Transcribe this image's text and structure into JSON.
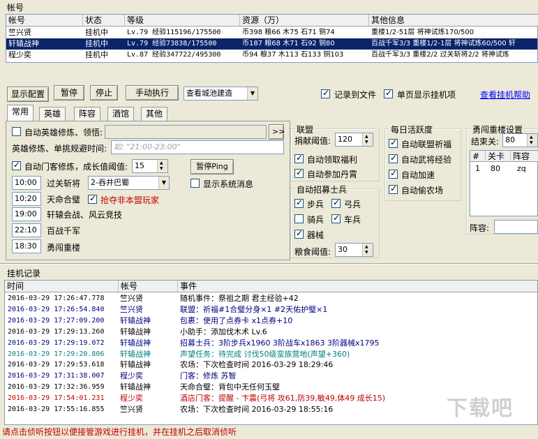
{
  "accounts": {
    "section_title": "帐号",
    "columns": [
      "帐号",
      "状态",
      "等级",
      "资源（万）",
      "其他信息"
    ],
    "rows": [
      {
        "name": "竺兴贤",
        "status": "挂机中",
        "level": "Lv.79 经验115196/175500",
        "res": "币398 粮66 木75 石71 铜74",
        "other": "重楼1/2-51层 将神试炼170/500"
      },
      {
        "name": "轩辕战神",
        "status": "挂机中",
        "level": "Lv.79 经验73838/175500",
        "res": "币187 粮68 木71 石92 铜80",
        "other": "百战千军3/3 重楼1/2-1层 将神试炼60/500 轩"
      },
      {
        "name": "程少奕",
        "status": "挂机中",
        "level": "Lv.87 经验347722/495300",
        "res": "币94 粮37 木113 石133 铜103",
        "other": "百战千军3/3 重楼2/2 过关斩将2/2 将神试炼"
      }
    ]
  },
  "toolbar": {
    "show_config": "显示配置",
    "pause": "暂停",
    "stop": "停止",
    "manual": "手动执行",
    "select_value": "查看城池建造",
    "record_file": "记录到文件",
    "single_page": "单页显示挂机项",
    "help_link": "查看挂机帮助"
  },
  "tabs": [
    "常用",
    "英雄",
    "阵容",
    "酒馆",
    "其他"
  ],
  "common": {
    "auto_hero": "自动英雄修炼、领悟:",
    "hero_time_label": "英雄修炼、单挑规避时间:",
    "hero_time_placeholder": "如: \"21:00-23:00\"",
    "auto_guest": "自动门客修炼，成长值阈值:",
    "guest_value": "15",
    "pause_ping": "暂停Ping",
    "show_sys_msg": "显示系统消息",
    "schedule": [
      {
        "time": "10:00",
        "label": "过关斩将"
      },
      {
        "time": "10:20",
        "label": "天命合璧"
      },
      {
        "time": "19:00",
        "label": "轩辕会战、风云竞技"
      },
      {
        "time": "22:10",
        "label": "百战千军"
      },
      {
        "time": "18:30",
        "label": "勇闯重楼"
      }
    ],
    "guanqia_select": "2-吞并巴蜀",
    "grab_non_alliance": "抢夺非本盟玩家"
  },
  "alliance": {
    "title": "联盟",
    "donate_label": "捐献阈值:",
    "donate_value": "120",
    "auto_benefit": "自动领取福利",
    "auto_pill": "自动参加丹霄"
  },
  "recruit": {
    "title": "自动招募士兵",
    "infantry": "步兵",
    "archer": "弓兵",
    "cavalry": "骑兵",
    "chariot": "车兵",
    "machine": "器械",
    "food_label": "粮食阈值:",
    "food_value": "30"
  },
  "daily": {
    "title": "每日活跃度",
    "items": [
      "自动联盟祈福",
      "自动武将经验",
      "自动加速",
      "自动偷农场"
    ]
  },
  "tower": {
    "title": "勇闯重楼设置",
    "end_label": "结束关:",
    "end_value": "80",
    "columns": [
      "#",
      "关卡",
      "阵容"
    ],
    "rows": [
      {
        "num": "1",
        "stage": "80",
        "team": "zq"
      }
    ],
    "team_label": "阵容:"
  },
  "log": {
    "title": "挂机记录",
    "columns": [
      "时间",
      "帐号",
      "事件"
    ],
    "rows": [
      {
        "time": "2016-03-29 17:26:47.778",
        "account": "竺兴贤",
        "event": "随机事件：祭祖之期 君主经验+42",
        "color": "#000000"
      },
      {
        "time": "2016-03-29 17:26:54.840",
        "account": "竺兴贤",
        "event": "联盟：祈福#1合璧分身×1 #2天佑护璧×1",
        "color": "#000080"
      },
      {
        "time": "2016-03-29 17:27:09.200",
        "account": "轩辕战神",
        "event": "包裹：使用了点券卡 x1点券+10",
        "color": "#000080"
      },
      {
        "time": "2016-03-29 17:29:13.260",
        "account": "轩辕战神",
        "event": "小助手：添加伐木术 Lv.6",
        "color": "#000000"
      },
      {
        "time": "2016-03-29 17:29:19.072",
        "account": "轩辕战神",
        "event": "招募士兵：3阶步兵x1960 3阶战车x1863 3阶器械x1795",
        "color": "#000080"
      },
      {
        "time": "2016-03-29 17:29:20.806",
        "account": "轩辕战神",
        "event": "声望任务：待完成 讨伐50级蛮族营地(声望+360)",
        "color": "#008080"
      },
      {
        "time": "2016-03-29 17:29:53.618",
        "account": "轩辕战神",
        "event": "农场：下次检查时间 2016-03-29 18:29:46",
        "color": "#000000"
      },
      {
        "time": "2016-03-29 17:31:38.007",
        "account": "程少奕",
        "event": "门客：修炼 苏智",
        "color": "#000080"
      },
      {
        "time": "2016-03-29 17:32:36.959",
        "account": "轩辕战神",
        "event": "天命合璧：背包中无任何玉璧",
        "color": "#000000"
      },
      {
        "time": "2016-03-29 17:54:01.231",
        "account": "程少奕",
        "event": "酒店门客：提醒 - 卞震(弓将 攻61,防39,敏49,体49 成长15)",
        "color": "#c00000"
      },
      {
        "time": "2016-03-29 17:55:16.855",
        "account": "竺兴贤",
        "event": "农场：下次检查时间 2016-03-29 18:55:16",
        "color": "#000000"
      }
    ]
  },
  "status_bar": "请点击侦听按钮以便接管游戏进行挂机，并在挂机之后取消侦听",
  "watermark": "下载吧"
}
